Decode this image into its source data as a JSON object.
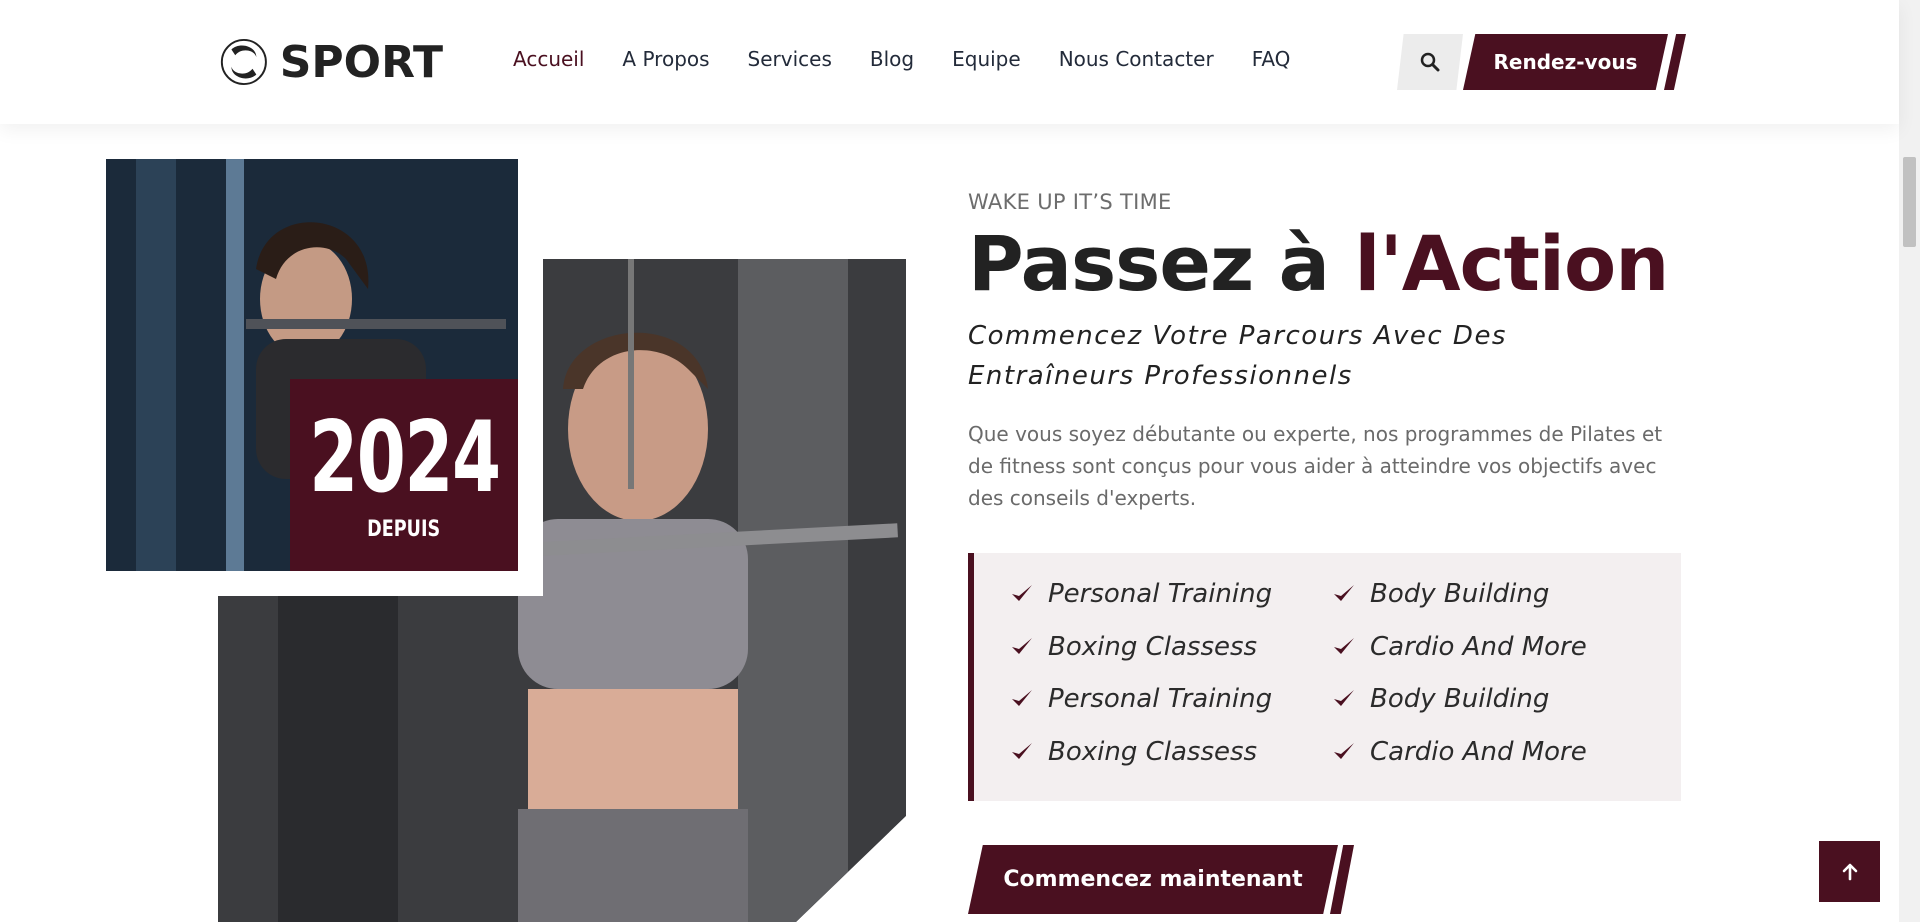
{
  "header": {
    "logo_text": "SPORT",
    "nav": [
      {
        "label": "Accueil",
        "active": true
      },
      {
        "label": "A Propos"
      },
      {
        "label": "Services"
      },
      {
        "label": "Blog"
      },
      {
        "label": "Equipe"
      },
      {
        "label": "Nous Contacter"
      },
      {
        "label": "FAQ"
      }
    ],
    "search_icon": "search-icon",
    "cta_label": "Rendez-vous"
  },
  "hero": {
    "badge_year": "2024",
    "badge_label": "DEPUIS",
    "eyebrow": "WAKE UP IT’S TIME",
    "headline_part1": "Passez à ",
    "headline_part2": "l'Action",
    "subhead": "Commencez Votre Parcours Avec Des Entraîneurs Professionnels",
    "paragraph": "Que vous soyez débutante ou experte, nos programmes de Pilates et de fitness sont conçus pour vous aider à atteindre vos objectifs avec des conseils d'experts.",
    "features_left": [
      "Personal Training",
      "Boxing Classess",
      "Personal Training",
      "Boxing Classess"
    ],
    "features_right": [
      "Body Building",
      "Cardio And More",
      "Body Building",
      "Cardio And More"
    ],
    "cta_label": "Commencez maintenant"
  },
  "colors": {
    "accent": "#4a1020",
    "text": "#222222",
    "muted": "#6a6a6a",
    "panel": "#f3eff0"
  },
  "scroll_top_icon": "arrow-up-icon"
}
